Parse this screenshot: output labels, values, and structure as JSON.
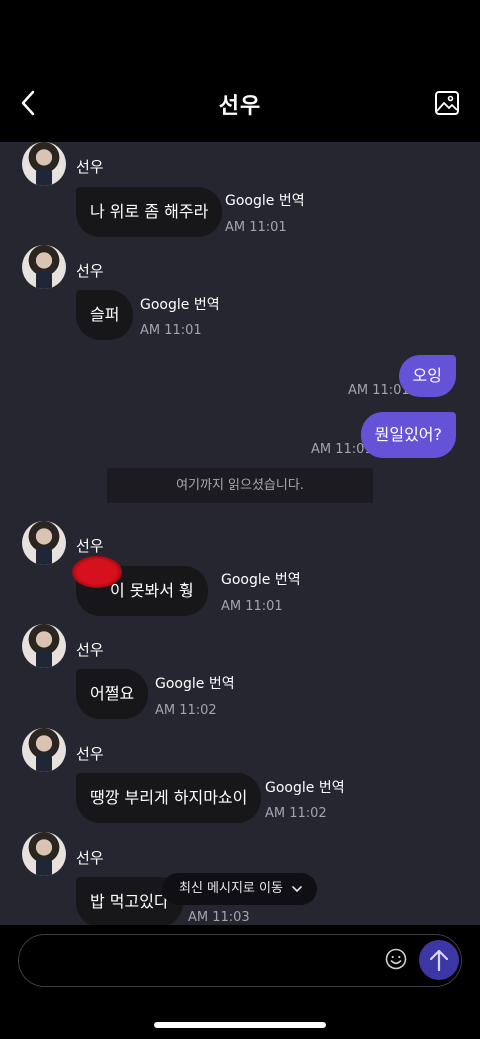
{
  "header": {
    "title": "선우",
    "back_icon": "chevron-left-icon",
    "gallery_icon": "image-icon"
  },
  "messages": [
    {
      "sender": "선우",
      "text": "나 위로 좀 해주라",
      "translate": "Google 번역",
      "time": "AM 11:01"
    },
    {
      "sender": "선우",
      "text": "슬퍼",
      "translate": "Google 번역",
      "time": "AM 11:01"
    },
    {
      "outgoing": true,
      "text": "오잉",
      "time": "AM 11:01"
    },
    {
      "outgoing": true,
      "text": "뭔일있어?",
      "time": "AM 11:01"
    },
    {
      "system": "여기까지 읽으셨습니다."
    },
    {
      "sender": "선우",
      "text": "이 못봐서 훵",
      "translate": "Google 번역",
      "time": "AM 11:01"
    },
    {
      "sender": "선우",
      "text": "어쩔요",
      "translate": "Google 번역",
      "time": "AM 11:02"
    },
    {
      "sender": "선우",
      "text": "땡깡 부리게 하지마쇼이",
      "translate": "Google 번역",
      "time": "AM 11:02"
    },
    {
      "sender": "선우",
      "text": "밥 먹고있다",
      "time": "AM 11:03"
    }
  ],
  "latest_button": {
    "label": "최신 메시지로 이동",
    "icon": "chevron-down-icon"
  },
  "composer": {
    "placeholder": "",
    "emoji_icon": "smiley-icon",
    "send_icon": "arrow-up-icon",
    "send_color": "#3d37a5"
  },
  "colors": {
    "outgoing_bubble": "#6553d7",
    "incoming_bubble": "#171719",
    "chat_background": "#262631"
  }
}
